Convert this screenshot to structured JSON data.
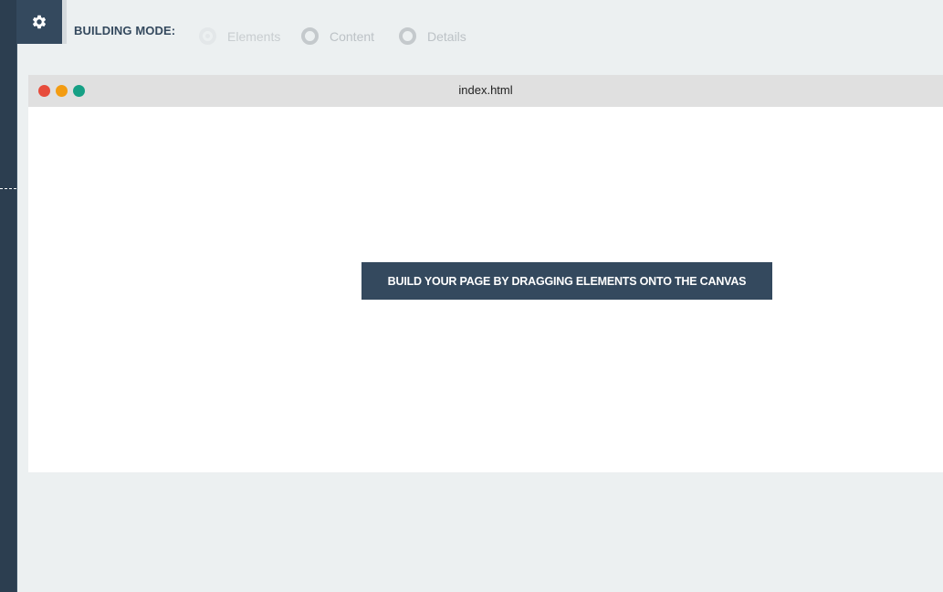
{
  "toolbar": {
    "settings_icon": "gear-icon",
    "mode_label": "BUILDING MODE:",
    "modes": [
      {
        "label": "Elements",
        "selected": true
      },
      {
        "label": "Content",
        "selected": false
      },
      {
        "label": "Details",
        "selected": false
      }
    ]
  },
  "window": {
    "title": "index.html",
    "traffic_lights": {
      "close": "#e74c3c",
      "minimize": "#f39c12",
      "zoom": "#16a085"
    }
  },
  "canvas": {
    "placeholder": "BUILD YOUR PAGE BY DRAGGING ELEMENTS ONTO THE CANVAS"
  },
  "colors": {
    "primary": "#34495e",
    "background": "#ecf0f1"
  }
}
